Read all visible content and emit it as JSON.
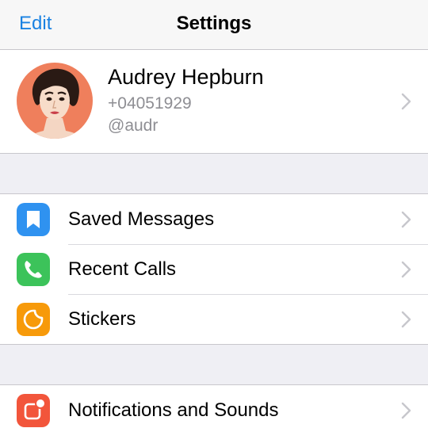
{
  "navbar": {
    "edit_label": "Edit",
    "title": "Settings"
  },
  "profile": {
    "name": "Audrey Hepburn",
    "phone": "+04051929",
    "username": "@audr"
  },
  "colors": {
    "accent": "#1a82e2",
    "saved_messages_icon_bg": "#2f92f0",
    "recent_calls_icon_bg": "#3cc35a",
    "stickers_icon_bg": "#f79a0a",
    "notifications_icon_bg": "#f2553b",
    "avatar_bg": "#ef7f5c"
  },
  "groups": [
    {
      "items": [
        {
          "label": "Saved Messages",
          "icon": "bookmark-icon"
        },
        {
          "label": "Recent Calls",
          "icon": "phone-icon"
        },
        {
          "label": "Stickers",
          "icon": "sticker-icon"
        }
      ]
    },
    {
      "items": [
        {
          "label": "Notifications and Sounds",
          "icon": "notification-icon"
        }
      ]
    }
  ]
}
